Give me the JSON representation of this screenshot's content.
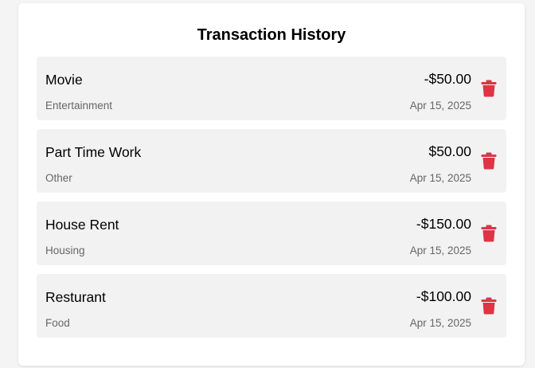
{
  "header": {
    "title": "Transaction History"
  },
  "colors": {
    "delete_icon": "#dc3545",
    "item_background": "#f2f2f2",
    "secondary_text": "#666666"
  },
  "transactions": [
    {
      "name": "Movie",
      "category": "Entertainment",
      "amount": "-$50.00",
      "date": "Apr 15, 2025",
      "icon": "trash-icon"
    },
    {
      "name": "Part Time Work",
      "category": "Other",
      "amount": "$50.00",
      "date": "Apr 15, 2025",
      "icon": "trash-icon"
    },
    {
      "name": "House Rent",
      "category": "Housing",
      "amount": "-$150.00",
      "date": "Apr 15, 2025",
      "icon": "trash-icon"
    },
    {
      "name": "Resturant",
      "category": "Food",
      "amount": "-$100.00",
      "date": "Apr 15, 2025",
      "icon": "trash-icon"
    }
  ]
}
